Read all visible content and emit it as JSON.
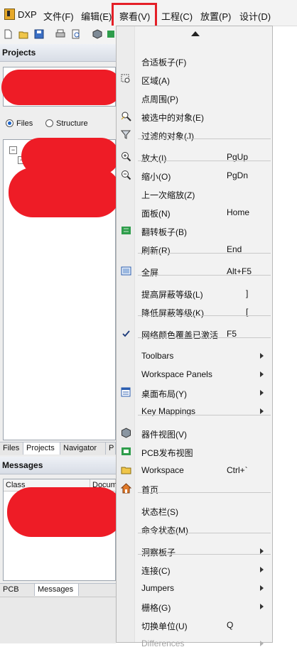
{
  "menubar": {
    "items": [
      "DXP",
      "文件(F)",
      "编辑(E)",
      "察看(V)",
      "工程(C)",
      "放置(P)",
      "设计(D)"
    ]
  },
  "left": {
    "projects_title": "Projects",
    "radio_files": "Files",
    "radio_structure": "Structure",
    "top_tabs": [
      "Files",
      "Projects",
      "Navigator",
      "P"
    ],
    "messages_title": "Messages",
    "msg_columns": [
      "Class",
      "Docum"
    ],
    "bottom_tabs": [
      "PCB List",
      "Messages"
    ]
  },
  "menu": {
    "items": [
      {
        "label": "合适板子(F)",
        "shortcut": "",
        "icon": "",
        "submenu": false,
        "disabled": false
      },
      {
        "label": "区域(A)",
        "shortcut": "",
        "icon": "zoom-area-icon",
        "submenu": false,
        "disabled": false
      },
      {
        "label": "点周围(P)",
        "shortcut": "",
        "icon": "",
        "submenu": false,
        "disabled": false
      },
      {
        "label": "被选中的对象(E)",
        "shortcut": "",
        "icon": "zoom-selected-icon",
        "submenu": false,
        "disabled": false
      },
      {
        "label": "过滤的对象(J)",
        "shortcut": "",
        "icon": "filter-icon",
        "submenu": false,
        "disabled": false
      },
      {
        "label": "放大(I)",
        "shortcut": "PgUp",
        "icon": "zoom-in-icon",
        "submenu": false,
        "disabled": false
      },
      {
        "label": "缩小(O)",
        "shortcut": "PgDn",
        "icon": "zoom-out-icon",
        "submenu": false,
        "disabled": false
      },
      {
        "label": "上一次缩放(Z)",
        "shortcut": "",
        "icon": "",
        "submenu": false,
        "disabled": false
      },
      {
        "label": "面板(N)",
        "shortcut": "Home",
        "icon": "",
        "submenu": false,
        "disabled": false
      },
      {
        "label": "翻转板子(B)",
        "shortcut": "",
        "icon": "flip-board-icon",
        "submenu": false,
        "disabled": false
      },
      {
        "label": "刷新(R)",
        "shortcut": "End",
        "icon": "",
        "submenu": false,
        "disabled": false
      },
      {
        "label": "全屏",
        "shortcut": "Alt+F5",
        "icon": "fullscreen-icon",
        "submenu": false,
        "disabled": false
      },
      {
        "label": "提高屏蔽等级(L)",
        "shortcut": "]",
        "icon": "",
        "submenu": false,
        "disabled": false
      },
      {
        "label": "降低屏蔽等级(K)",
        "shortcut": "[",
        "icon": "",
        "submenu": false,
        "disabled": false
      },
      {
        "label": "网络颜色覆盖已激活",
        "shortcut": "F5",
        "icon": "checkmark-icon",
        "submenu": false,
        "disabled": false
      },
      {
        "label": "Toolbars",
        "shortcut": "",
        "icon": "",
        "submenu": true,
        "disabled": false
      },
      {
        "label": "Workspace Panels",
        "shortcut": "",
        "icon": "",
        "submenu": true,
        "disabled": false
      },
      {
        "label": "桌面布局(Y)",
        "shortcut": "",
        "icon": "desktop-layout-icon",
        "submenu": true,
        "disabled": false
      },
      {
        "label": "Key Mappings",
        "shortcut": "",
        "icon": "",
        "submenu": true,
        "disabled": false
      },
      {
        "label": "器件视图(V)",
        "shortcut": "",
        "icon": "component-view-icon",
        "submenu": false,
        "disabled": false
      },
      {
        "label": "PCB发布视图",
        "shortcut": "",
        "icon": "pcb-release-icon",
        "submenu": false,
        "disabled": false
      },
      {
        "label": "Workspace",
        "shortcut": "Ctrl+`",
        "icon": "workspace-icon",
        "submenu": false,
        "disabled": false
      },
      {
        "label": "首页",
        "shortcut": "",
        "icon": "home-icon",
        "submenu": false,
        "disabled": false
      },
      {
        "label": "状态栏(S)",
        "shortcut": "",
        "icon": "",
        "submenu": false,
        "disabled": false
      },
      {
        "label": "命令状态(M)",
        "shortcut": "",
        "icon": "",
        "submenu": false,
        "disabled": false
      },
      {
        "label": "洞察板子",
        "shortcut": "",
        "icon": "",
        "submenu": true,
        "disabled": false
      },
      {
        "label": "连接(C)",
        "shortcut": "",
        "icon": "",
        "submenu": true,
        "disabled": false
      },
      {
        "label": "Jumpers",
        "shortcut": "",
        "icon": "",
        "submenu": true,
        "disabled": false
      },
      {
        "label": "栅格(G)",
        "shortcut": "",
        "icon": "",
        "submenu": true,
        "disabled": false
      },
      {
        "label": "切换单位(U)",
        "shortcut": "Q",
        "icon": "",
        "submenu": false,
        "disabled": false
      },
      {
        "label": "Differences",
        "shortcut": "",
        "icon": "",
        "submenu": true,
        "disabled": true
      }
    ]
  },
  "colors": {
    "accent": "#1b63c9",
    "highlight": "#e41f27",
    "redaction": "#ee1c26"
  }
}
